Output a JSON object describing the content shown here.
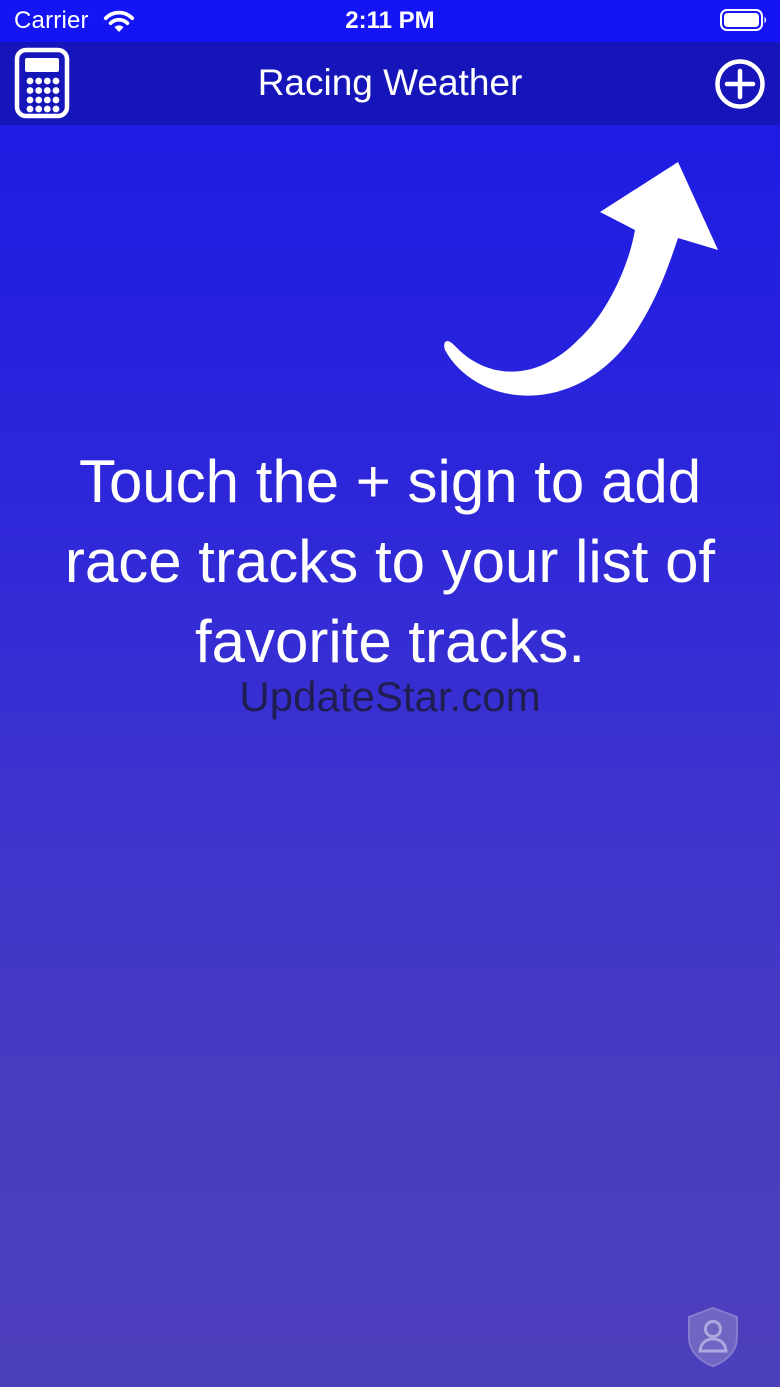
{
  "status_bar": {
    "carrier": "Carrier",
    "time": "2:11 PM",
    "wifi_icon": "wifi-icon",
    "battery_icon": "battery-icon"
  },
  "nav_bar": {
    "title": "Racing Weather",
    "left_icon": "calculator-icon",
    "right_icon": "plus-circle-icon"
  },
  "main": {
    "arrow_icon": "curved-arrow-icon",
    "instruction": "Touch the + sign to add race tracks to your list of favorite tracks.",
    "watermark": "UpdateStar.com",
    "corner_icon": "shield-user-icon"
  },
  "colors": {
    "status_bar": "#1414f4",
    "nav_bar": "#1515b9",
    "gradient_top": "#1818e6",
    "gradient_bottom": "#4c3fbb",
    "text": "#ffffff",
    "watermark": "#1e1c44"
  }
}
